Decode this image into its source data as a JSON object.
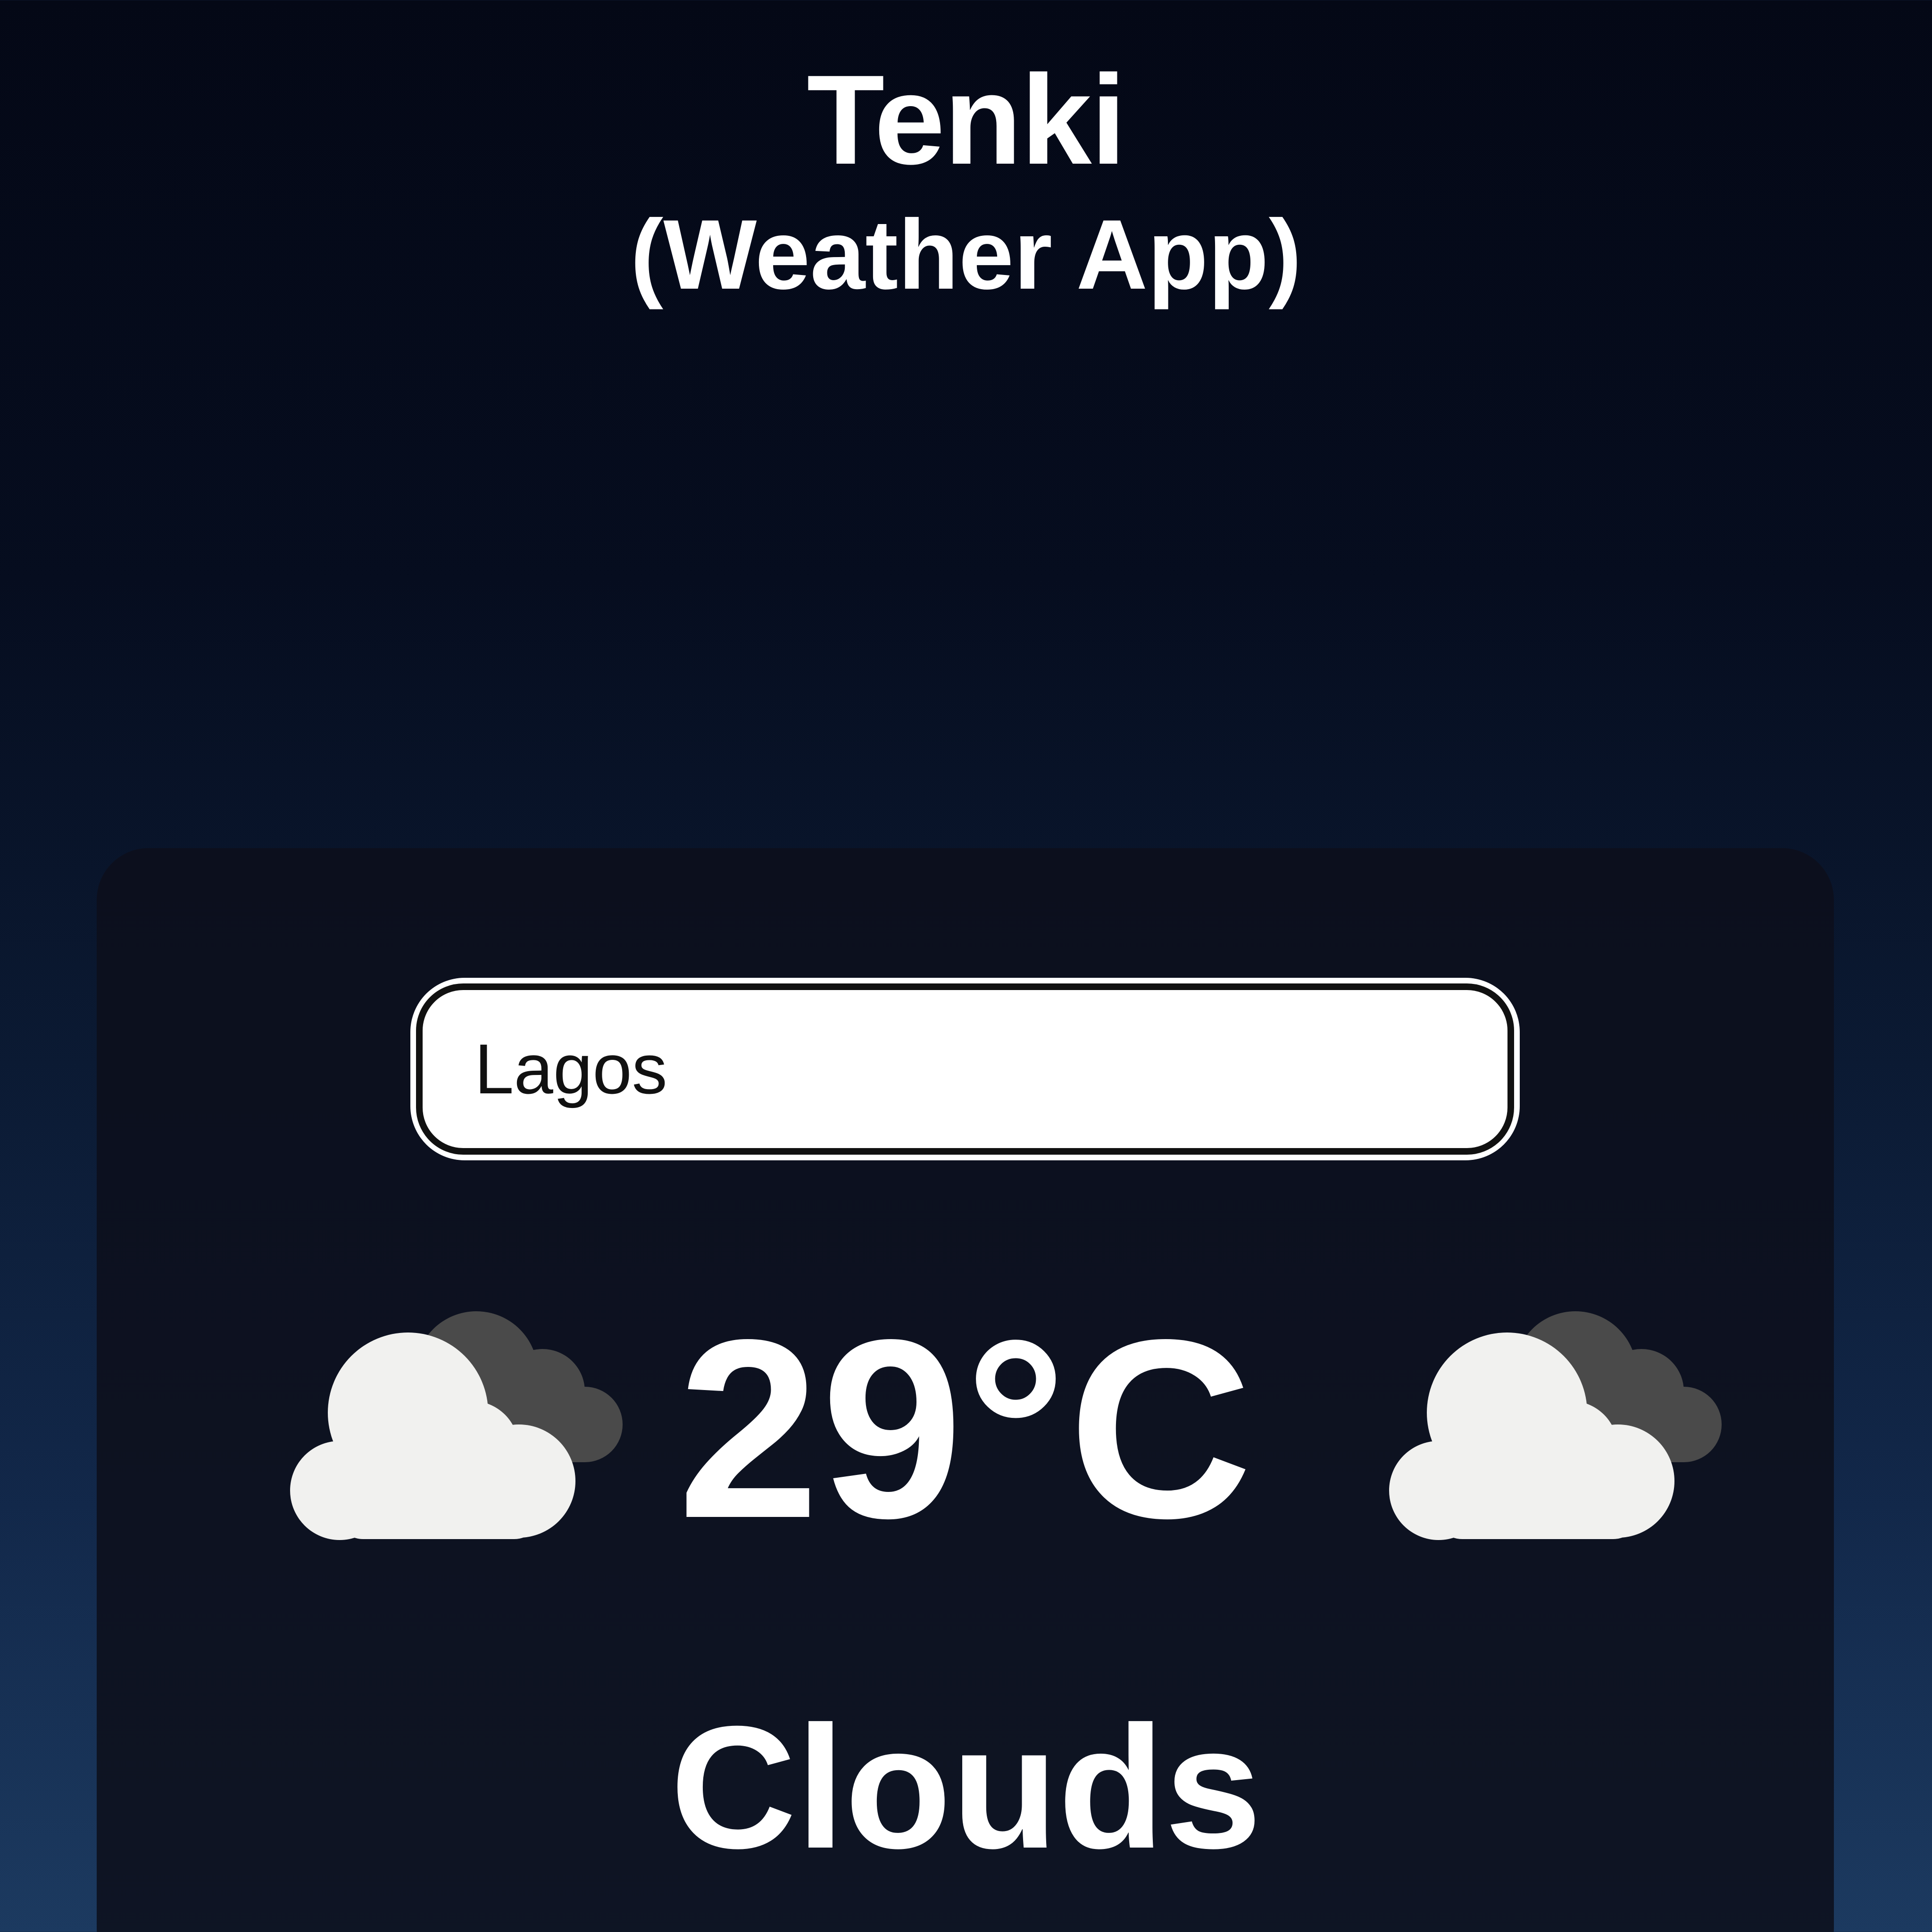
{
  "app": {
    "title": "Tenki",
    "subtitle": "(Weather App)"
  },
  "search": {
    "value": "Lagos"
  },
  "weather": {
    "temperature": "29°C",
    "condition": "Clouds",
    "icon": "cloud-icon"
  },
  "colors": {
    "background_top": "#040816",
    "background_bottom": "#1c3a60",
    "card": "#0c0f1d",
    "text": "#ffffff",
    "cloud_front": "#f1f1ef",
    "cloud_back": "#4a4a4a"
  }
}
